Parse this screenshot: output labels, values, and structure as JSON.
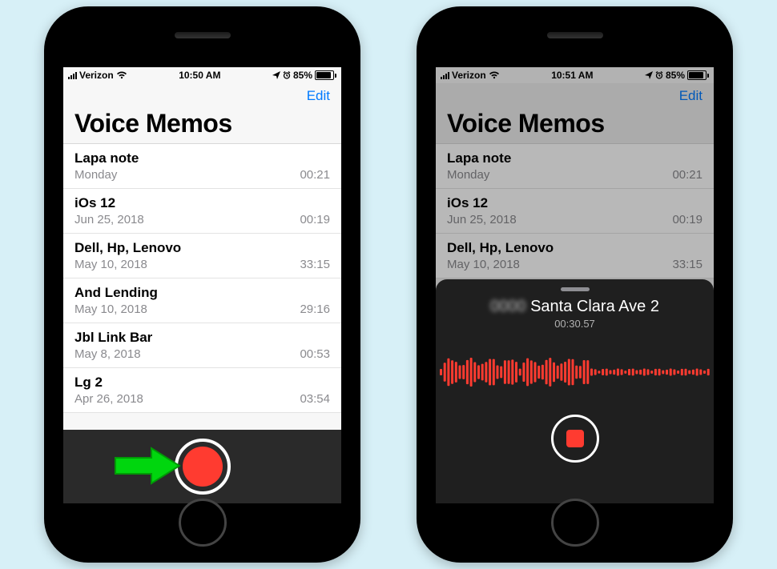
{
  "left": {
    "status": {
      "carrier": "Verizon",
      "time": "10:50 AM",
      "battery_pct": "85%"
    },
    "nav": {
      "edit": "Edit"
    },
    "title": "Voice Memos",
    "memos": [
      {
        "title": "Lapa note",
        "date": "Monday",
        "dur": "00:21"
      },
      {
        "title": "iOs 12",
        "date": "Jun 25, 2018",
        "dur": "00:19"
      },
      {
        "title": "Dell, Hp, Lenovo",
        "date": "May 10, 2018",
        "dur": "33:15"
      },
      {
        "title": "And Lending",
        "date": "May 10, 2018",
        "dur": "29:16"
      },
      {
        "title": "Jbl Link Bar",
        "date": "May 8, 2018",
        "dur": "00:53"
      },
      {
        "title": "Lg 2",
        "date": "Apr 26, 2018",
        "dur": "03:54"
      }
    ]
  },
  "right": {
    "status": {
      "carrier": "Verizon",
      "time": "10:51 AM",
      "battery_pct": "85%"
    },
    "nav": {
      "edit": "Edit"
    },
    "title": "Voice Memos",
    "memos": [
      {
        "title": "Lapa note",
        "date": "Monday",
        "dur": "00:21"
      },
      {
        "title": "iOs 12",
        "date": "Jun 25, 2018",
        "dur": "00:19"
      },
      {
        "title": "Dell, Hp, Lenovo",
        "date": "May 10, 2018",
        "dur": "33:15"
      }
    ],
    "recording": {
      "name_suffix": "Santa Clara Ave 2",
      "elapsed": "00:30.57"
    }
  },
  "colors": {
    "accent_blue": "#007aff",
    "record_red": "#ff3b30",
    "arrow_green": "#00d60e"
  }
}
